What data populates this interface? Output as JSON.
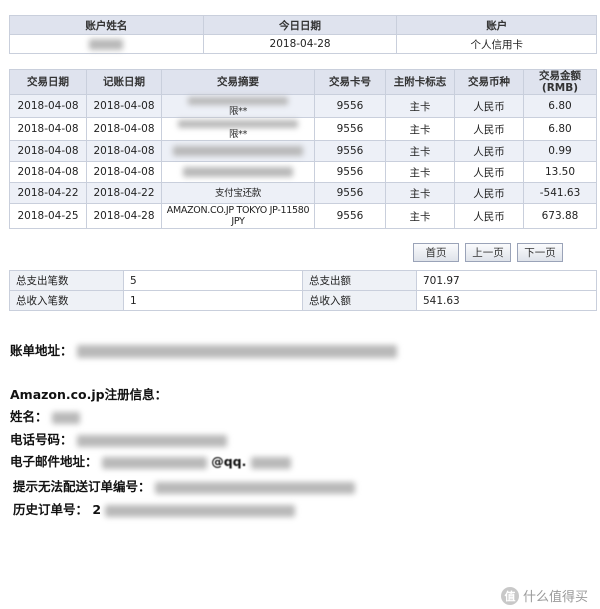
{
  "header_table": {
    "columns": [
      "账户姓名",
      "今日日期",
      "账户"
    ],
    "today": "2018-04-28",
    "account": "个人信用卡"
  },
  "transactions": {
    "columns": [
      "交易日期",
      "记账日期",
      "交易摘要",
      "交易卡号",
      "主附卡标志",
      "交易币种",
      "交易金额\n(RMB)"
    ],
    "rows": [
      {
        "trans_date": "2018-04-08",
        "post_date": "2018-04-08",
        "summary": "限**",
        "card": "9556",
        "flag": "主卡",
        "currency": "人民币",
        "amount": "6.80"
      },
      {
        "trans_date": "2018-04-08",
        "post_date": "2018-04-08",
        "summary": "限**",
        "card": "9556",
        "flag": "主卡",
        "currency": "人民币",
        "amount": "6.80"
      },
      {
        "trans_date": "2018-04-08",
        "post_date": "2018-04-08",
        "summary": "",
        "card": "9556",
        "flag": "主卡",
        "currency": "人民币",
        "amount": "0.99"
      },
      {
        "trans_date": "2018-04-08",
        "post_date": "2018-04-08",
        "summary": "",
        "card": "9556",
        "flag": "主卡",
        "currency": "人民币",
        "amount": "13.50"
      },
      {
        "trans_date": "2018-04-22",
        "post_date": "2018-04-22",
        "summary": "支付宝还款",
        "card": "9556",
        "flag": "主卡",
        "currency": "人民币",
        "amount": "-541.63"
      },
      {
        "trans_date": "2018-04-25",
        "post_date": "2018-04-28",
        "summary": "AMAZON.CO.JP TOKYO JP-11580 JPY",
        "card": "9556",
        "flag": "主卡",
        "currency": "人民币",
        "amount": "673.88"
      }
    ]
  },
  "pager": {
    "first": "首页",
    "prev": "上一页",
    "next": "下一页"
  },
  "summary": {
    "expense_count_label": "总支出笔数",
    "expense_count": "5",
    "expense_total_label": "总支出额",
    "expense_total": "701.97",
    "income_count_label": "总收入笔数",
    "income_count": "1",
    "income_total_label": "总收入额",
    "income_total": "541.63"
  },
  "info": {
    "bill_address_label": "账单地址：",
    "amazon_heading": "Amazon.co.jp注册信息：",
    "name_label": "姓名：",
    "phone_label": "电话号码：",
    "email_label": "电子邮件地址：",
    "email_partial": "@qq.",
    "undeliverable_label": "提示无法配送订单编号：",
    "history_label": "历史订单号：",
    "history_partial": "2"
  },
  "watermark": {
    "logo": "值",
    "text": "什么值得买"
  }
}
